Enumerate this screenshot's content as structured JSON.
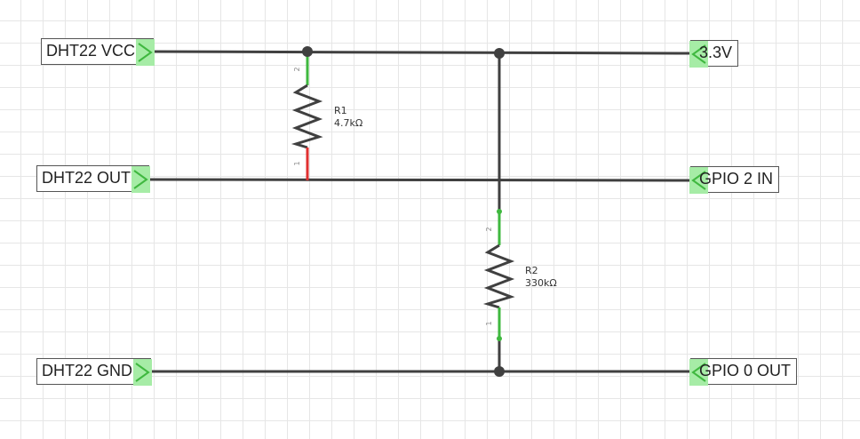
{
  "net_labels": {
    "dht22_vcc": "DHT22 VCC",
    "dht22_out": "DHT22 OUT",
    "dht22_gnd": "DHT22 GND",
    "v33": "3.3V",
    "gpio2_in": "GPIO 2 IN",
    "gpio0_out": "GPIO 0 OUT"
  },
  "components": {
    "r1": {
      "ref": "R1",
      "value": "4.7kΩ",
      "pin_top": "2",
      "pin_bottom": "1"
    },
    "r2": {
      "ref": "R2",
      "value": "330kΩ",
      "pin_top": "2",
      "pin_bottom": "1"
    }
  },
  "colors": {
    "wire": "#404040",
    "connected_lead": "#3fb83f",
    "unconnected_lead": "#e03030",
    "connector_fill": "#a6eca6",
    "grid": "#e6e6e6"
  }
}
